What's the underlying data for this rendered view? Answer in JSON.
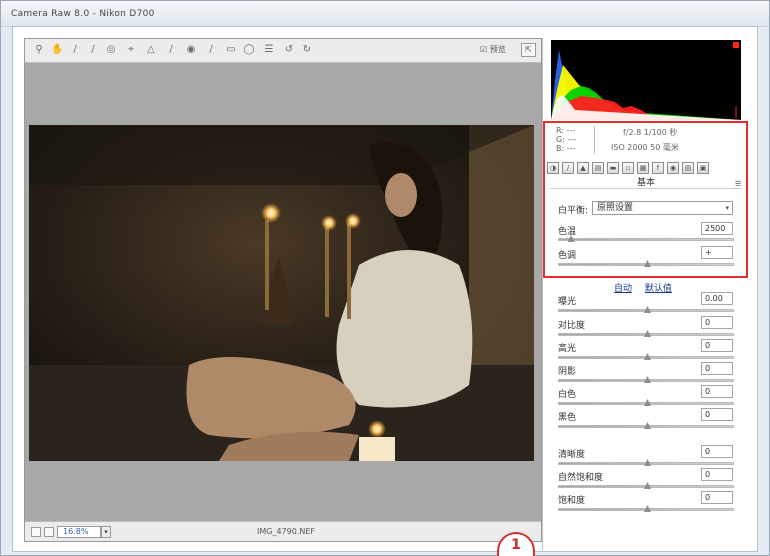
{
  "window": {
    "title": "Camera Raw 8.0 - Nikon D700"
  },
  "toolbar": {
    "tools": [
      "zoom-icon",
      "hand-icon",
      "white-balance-icon",
      "color-sampler-icon",
      "target-adjust-icon",
      "crop-icon",
      "straighten-icon",
      "spot-removal-icon",
      "red-eye-icon",
      "adjustment-brush-icon",
      "graduated-filter-icon",
      "radial-filter-icon",
      "preferences-icon",
      "rotate-left-icon",
      "rotate-right-icon"
    ],
    "preview_label": "预览",
    "fullscreen_icon": "fullscreen-icon"
  },
  "statusbar": {
    "zoom": "16.8%",
    "filename": "IMG_4790.NEF"
  },
  "annotation": {
    "number": "1",
    "color": "#d23232"
  },
  "info": {
    "r": "R: ---",
    "g": "G: ---",
    "b": "B: ---",
    "exposure": "f/2.8   1/100 秒",
    "camera": "ISO 2000   50 毫米"
  },
  "basic": {
    "section_title": "基本",
    "wb_label": "白平衡:",
    "wb_value": "原照设置",
    "temperature_label": "色温",
    "temperature_value": "2500",
    "tint_label": "色调",
    "tint_value": "+",
    "auto_link": "自动",
    "default_link": "默认值",
    "sliders": [
      {
        "label": "曝光",
        "value": "0.00",
        "pos": 0.5
      },
      {
        "label": "对比度",
        "value": "0",
        "pos": 0.5
      },
      {
        "label": "高光",
        "value": "0",
        "pos": 0.5
      },
      {
        "label": "阴影",
        "value": "0",
        "pos": 0.5
      },
      {
        "label": "白色",
        "value": "0",
        "pos": 0.5
      },
      {
        "label": "黑色",
        "value": "0",
        "pos": 0.5
      },
      {
        "label": "清晰度",
        "value": "0",
        "pos": 0.5
      },
      {
        "label": "自然饱和度",
        "value": "0",
        "pos": 0.5
      },
      {
        "label": "饱和度",
        "value": "0",
        "pos": 0.5
      }
    ],
    "temperature_pos": 0.05,
    "tint_pos": 0.5
  },
  "colors": {
    "accent_red": "#e23030",
    "link": "#1a3c8c"
  }
}
